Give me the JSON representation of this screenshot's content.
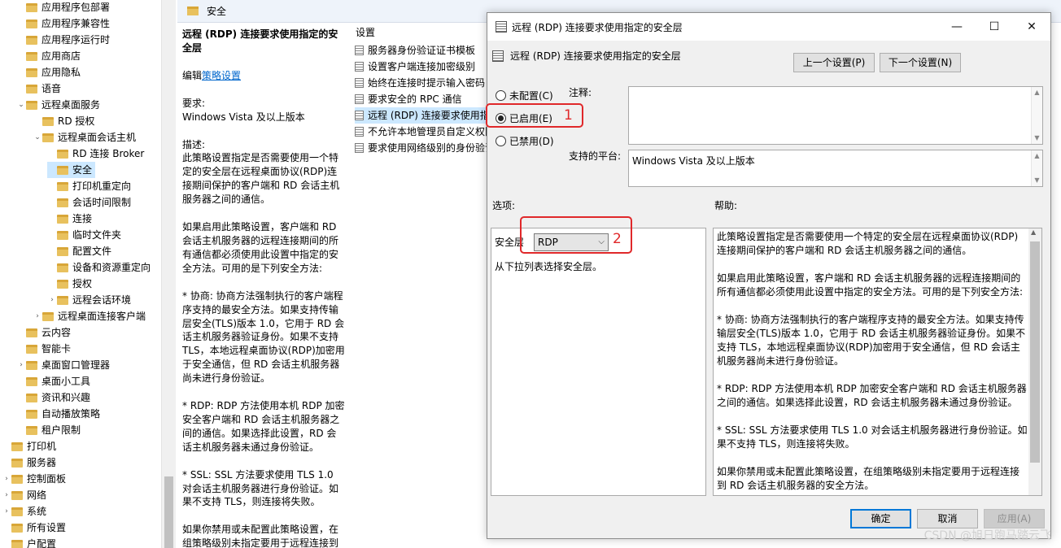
{
  "tree": {
    "items": [
      {
        "label": "应用程序包部署",
        "indent": 1,
        "expander": ""
      },
      {
        "label": "应用程序兼容性",
        "indent": 1,
        "expander": ""
      },
      {
        "label": "应用程序运行时",
        "indent": 1,
        "expander": ""
      },
      {
        "label": "应用商店",
        "indent": 1,
        "expander": ""
      },
      {
        "label": "应用隐私",
        "indent": 1,
        "expander": ""
      },
      {
        "label": "语音",
        "indent": 1,
        "expander": ""
      },
      {
        "label": "远程桌面服务",
        "indent": 1,
        "expander": "down"
      },
      {
        "label": "RD 授权",
        "indent": 2,
        "expander": ""
      },
      {
        "label": "远程桌面会话主机",
        "indent": 2,
        "expander": "down"
      },
      {
        "label": "RD 连接 Broker",
        "indent": 3,
        "expander": ""
      },
      {
        "label": "安全",
        "indent": 3,
        "expander": "",
        "selected": true
      },
      {
        "label": "打印机重定向",
        "indent": 3,
        "expander": ""
      },
      {
        "label": "会话时间限制",
        "indent": 3,
        "expander": ""
      },
      {
        "label": "连接",
        "indent": 3,
        "expander": ""
      },
      {
        "label": "临时文件夹",
        "indent": 3,
        "expander": ""
      },
      {
        "label": "配置文件",
        "indent": 3,
        "expander": ""
      },
      {
        "label": "设备和资源重定向",
        "indent": 3,
        "expander": ""
      },
      {
        "label": "授权",
        "indent": 3,
        "expander": ""
      },
      {
        "label": "远程会话环境",
        "indent": 3,
        "expander": "right"
      },
      {
        "label": "远程桌面连接客户端",
        "indent": 2,
        "expander": "right"
      },
      {
        "label": "云内容",
        "indent": 1,
        "expander": ""
      },
      {
        "label": "智能卡",
        "indent": 1,
        "expander": ""
      },
      {
        "label": "桌面窗口管理器",
        "indent": 1,
        "expander": "right"
      },
      {
        "label": "桌面小工具",
        "indent": 1,
        "expander": ""
      },
      {
        "label": "资讯和兴趣",
        "indent": 1,
        "expander": ""
      },
      {
        "label": "自动播放策略",
        "indent": 1,
        "expander": ""
      },
      {
        "label": "租户限制",
        "indent": 1,
        "expander": ""
      },
      {
        "label": "打印机",
        "indent": 0,
        "expander": ""
      },
      {
        "label": "服务器",
        "indent": 0,
        "expander": ""
      },
      {
        "label": "控制面板",
        "indent": 0,
        "expander": "right"
      },
      {
        "label": "网络",
        "indent": 0,
        "expander": "right"
      },
      {
        "label": "系统",
        "indent": 0,
        "expander": "right"
      },
      {
        "label": "所有设置",
        "indent": 0,
        "expander": ""
      },
      {
        "label": "户配置",
        "indent": 0,
        "expander": ""
      }
    ]
  },
  "header": {
    "title": "安全"
  },
  "description": {
    "title": "远程 (RDP) 连接要求使用指定的安全层",
    "edit_prefix": "编辑",
    "edit_link": "策略设置",
    "req_label": "要求:",
    "req_value": "Windows Vista 及以上版本",
    "desc_label": "描述:",
    "p1": "此策略设置指定是否需要使用一个特定的安全层在远程桌面协议(RDP)连接期间保护的客户端和 RD 会话主机服务器之间的通信。",
    "p2": "如果启用此策略设置，客户端和 RD 会话主机服务器的远程连接期间的所有通信都必须使用此设置中指定的安全方法。可用的是下列安全方法:",
    "p3": "* 协商: 协商方法强制执行的客户端程序支持的最安全方法。如果支持传输层安全(TLS)版本 1.0，它用于 RD 会话主机服务器验证身份。如果不支持 TLS，本地远程桌面协议(RDP)加密用于安全通信，但 RD 会话主机服务器尚未进行身份验证。",
    "p4": "* RDP: RDP 方法使用本机 RDP 加密安全客户端和 RD 会话主机服务器之间的通信。如果选择此设置，RD 会话主机服务器未通过身份验证。",
    "p5": "* SSL: SSL 方法要求使用 TLS 1.0 对会话主机服务器进行身份验证。如果不支持 TLS，则连接将失败。",
    "p6": "如果你禁用或未配置此策略设置，在组策略级别未指定要用于远程连接到"
  },
  "settings_list": {
    "header": "设置",
    "items": [
      {
        "label": "服务器身份验证证书模板"
      },
      {
        "label": "设置客户端连接加密级别"
      },
      {
        "label": "始终在连接时提示输入密码"
      },
      {
        "label": "要求安全的 RPC 通信"
      },
      {
        "label": "远程 (RDP) 连接要求使用指定的安全层",
        "selected": true
      },
      {
        "label": "不允许本地管理员自定义权限"
      },
      {
        "label": "要求使用网络级别的身份验证"
      }
    ]
  },
  "dialog": {
    "title": "远程 (RDP) 连接要求使用指定的安全层",
    "heading": "远程 (RDP) 连接要求使用指定的安全层",
    "prev_button": "上一个设置(P)",
    "next_button": "下一个设置(N)",
    "radio_not_configured": "未配置(C)",
    "radio_enabled": "已启用(E)",
    "radio_disabled": "已禁用(D)",
    "comment_label": "注释:",
    "platform_label": "支持的平台:",
    "platform_value": "Windows Vista 及以上版本",
    "options_label": "选项:",
    "help_label": "帮助:",
    "security_layer_label": "安全层",
    "security_layer_value": "RDP",
    "select_hint": "从下拉列表选择安全层。",
    "help": {
      "p1": "此策略设置指定是否需要使用一个特定的安全层在远程桌面协议(RDP)连接期间保护的客户端和 RD 会话主机服务器之间的通信。",
      "p2": "如果启用此策略设置，客户端和 RD 会话主机服务器的远程连接期间的所有通信都必须使用此设置中指定的安全方法。可用的是下列安全方法:",
      "p3": "* 协商: 协商方法强制执行的客户端程序支持的最安全方法。如果支持传输层安全(TLS)版本 1.0，它用于 RD 会话主机服务器验证身份。如果不支持 TLS，本地远程桌面协议(RDP)加密用于安全通信，但 RD 会话主机服务器尚未进行身份验证。",
      "p4": "* RDP: RDP 方法使用本机 RDP 加密安全客户端和 RD 会话主机服务器之间的通信。如果选择此设置，RD 会话主机服务器未通过身份验证。",
      "p5": "* SSL: SSL 方法要求使用 TLS 1.0 对会话主机服务器进行身份验证。如果不支持 TLS，则连接将失败。",
      "p6": "如果你禁用或未配置此策略设置，在组策略级别未指定要用于远程连接到 RD 会话主机服务器的安全方法。"
    },
    "ok_button": "确定",
    "cancel_button": "取消",
    "apply_button": "应用(A)",
    "annot_1": "1",
    "annot_2": "2"
  },
  "watermark": "CSDN @旭日跑马踏云飞"
}
